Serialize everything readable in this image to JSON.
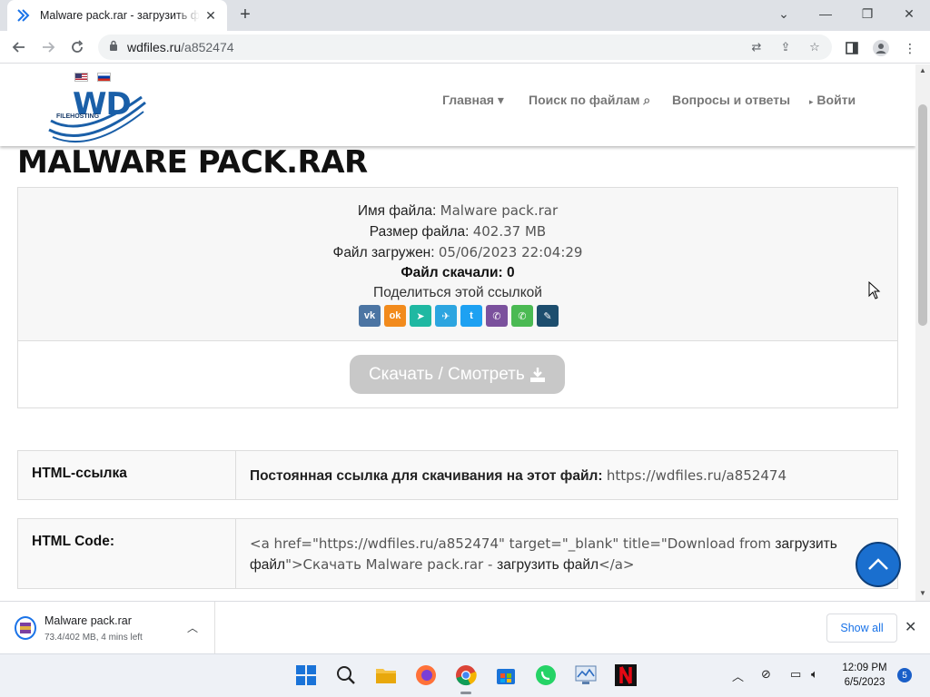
{
  "browser": {
    "tab_title": "Malware pack.rar - загрузить файл",
    "url_host": "wdfiles.ru",
    "url_path": "/a852474",
    "new_tab_label": "+"
  },
  "site": {
    "logo_text": "WD",
    "logo_sub": "FILEHOSTING",
    "nav": {
      "home": "Главная ▾",
      "search": "Поиск по файлам",
      "faq": "Вопросы и ответы",
      "login": "Войти"
    }
  },
  "file": {
    "title": "MALWARE PACK.RAR",
    "name_label": "Имя файла:",
    "name_value": "Malware pack.rar",
    "size_label": "Размер файла:",
    "size_value": "402.37 MB",
    "uploaded_label": "Файл загружен:",
    "uploaded_value": "05/06/2023 22:04:29",
    "downloads_text": "Файл скачали: 0",
    "share_text": "Поделиться этой ссылкой",
    "share_buttons": [
      {
        "name": "vk",
        "glyph": "vk",
        "color": "#4c75a3"
      },
      {
        "name": "odnoklassniki",
        "glyph": "ok",
        "color": "#f28b1d"
      },
      {
        "name": "yandex",
        "glyph": "➤",
        "color": "#1fb8a2"
      },
      {
        "name": "telegram",
        "glyph": "✈",
        "color": "#2ca5e0"
      },
      {
        "name": "twitter",
        "glyph": "t",
        "color": "#1da1f2"
      },
      {
        "name": "viber",
        "glyph": "✆",
        "color": "#7b519d"
      },
      {
        "name": "whatsapp",
        "glyph": "✆",
        "color": "#4bba53"
      },
      {
        "name": "livejournal",
        "glyph": "✎",
        "color": "#1d4e6e"
      }
    ],
    "download_button": "Скачать / Смотреть"
  },
  "links": {
    "html_link_label": "HTML-ссылка",
    "permalink_label": "Постоянная ссылка для скачивания на этот файл:",
    "permalink_value": "https://wdfiles.ru/a852474",
    "html_code_label": "HTML Code:",
    "html_code_line1_muted": "<a href=\"https://wdfiles.ru/a852474\" target=\"_blank\" title=\"Download from",
    "html_code_line1_dark": " загрузить",
    "html_code_line2_dark_a": "файл",
    "html_code_line2_muted_a": "\">Скачать Malware pack.rar - ",
    "html_code_line2_dark_b": "загрузить файл",
    "html_code_line2_muted_b": "</a>"
  },
  "download_bar": {
    "file_name": "Malware pack.rar",
    "status": "73.4/402 MB, 4 mins left",
    "show_all": "Show all"
  },
  "taskbar": {
    "time": "12:09 PM",
    "date": "6/5/2023",
    "notifications": "5"
  }
}
